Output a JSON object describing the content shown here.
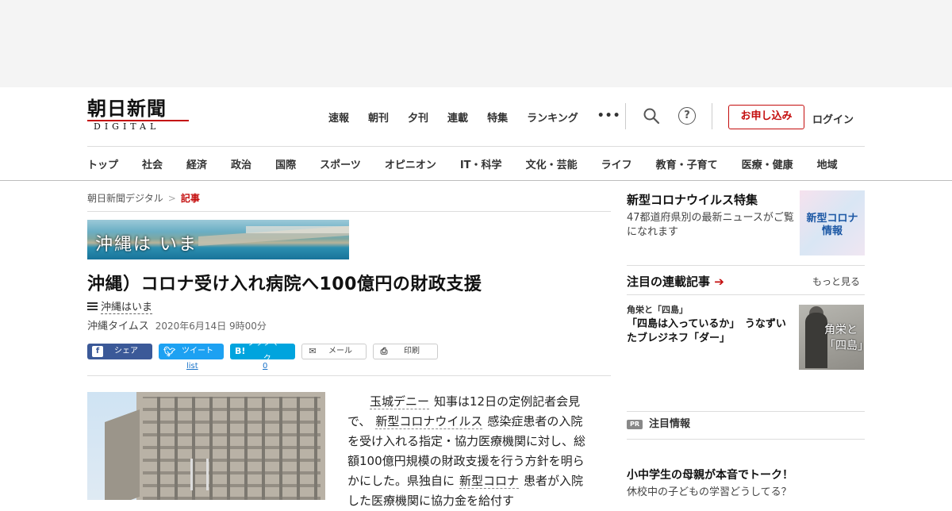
{
  "header": {
    "logo_main": "朝日新聞",
    "logo_sub": "DIGITAL",
    "topnav": [
      "速報",
      "朝刊",
      "夕刊",
      "連載",
      "特集",
      "ランキング"
    ],
    "more_glyph": "•••",
    "help_glyph": "?",
    "apply_label": "お申し込み",
    "login_label": "ログイン",
    "categories": [
      "トップ",
      "社会",
      "経済",
      "政治",
      "国際",
      "スポーツ",
      "オピニオン",
      "IT・科学",
      "文化・芸能",
      "ライフ",
      "教育・子育て",
      "医療・健康",
      "地域"
    ]
  },
  "breadcrumb": {
    "home": "朝日新聞デジタル",
    "sep": ">",
    "current": "記事"
  },
  "banner_text": "沖縄は いま",
  "article": {
    "headline": "沖縄）コロナ受け入れ病院へ100億円の財政支援",
    "series_label": "沖縄はいま",
    "source": "沖縄タイムス",
    "date": "2020年6月14日 9時00分",
    "body_kw1": "玉城デニー",
    "body_t1": "知事は12日の定例記者会見で、",
    "body_kw2": "新型コロナウイルス",
    "body_t2": "感染症患者の入院を受け入れる指定・協力医療機関に対し、総額100億円規模の財政支援を行う方針を明らかにした。県独自に",
    "body_kw3": "新型コロナ",
    "body_t3": "患者が入院した医療機関に協力金を給付す"
  },
  "share": {
    "facebook": "シェア",
    "twitter": "ツイート",
    "twitter_count": "list",
    "hatena_icon": "B!",
    "hatena": "ブックマーク",
    "hatena_count": "0",
    "mail": "メール",
    "print": "印刷"
  },
  "sidebar": {
    "corona_title": "新型コロナウイルス特集",
    "corona_desc": "47都道府県別の最新ニュースがご覧になれます",
    "corona_thumb_l1": "新型コロナ",
    "corona_thumb_l2": "情報",
    "series_title": "注目の連載記事",
    "series_arrow": "➔",
    "series_more": "もっと見る",
    "series_item_kicker": "角栄と「四島」",
    "series_item_title": "「四島は入っているか」　うなずいたブレジネフ「ダー」",
    "thumb_text_l1": "角栄と",
    "thumb_text_l2": "「四島」",
    "pr_badge": "PR",
    "pr_title": "注目情報",
    "pr_item_title": "小中学生の母親が本音でトーク！",
    "pr_item_desc": "休校中の子どもの学習どうしてる？"
  },
  "colors": {
    "brand_red": "#c40d0d",
    "facebook": "#3b5998",
    "twitter": "#1da1f2",
    "hatena": "#00a4de"
  }
}
